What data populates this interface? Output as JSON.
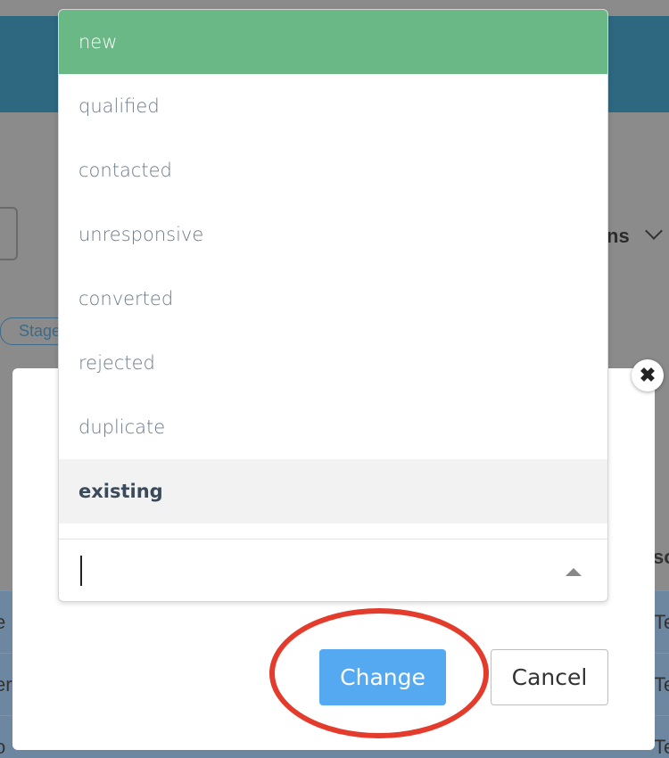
{
  "background": {
    "right_text": "ns",
    "tag_text": "Stage",
    "right_sliver_text": "so",
    "row_texts_left": [
      "e",
      "er",
      "o"
    ],
    "row_texts_right": [
      "Te",
      "Te",
      "Te"
    ]
  },
  "dropdown": {
    "options": [
      {
        "label": "new",
        "state": "highlighted"
      },
      {
        "label": "qualified",
        "state": "normal"
      },
      {
        "label": "contacted",
        "state": "normal"
      },
      {
        "label": "unresponsive",
        "state": "normal"
      },
      {
        "label": "converted",
        "state": "normal"
      },
      {
        "label": "rejected",
        "state": "normal"
      },
      {
        "label": "duplicate",
        "state": "normal"
      },
      {
        "label": "existing",
        "state": "selected"
      }
    ],
    "search_value": ""
  },
  "modal": {
    "close_icon": "close-icon",
    "change_label": "Change",
    "cancel_label": "Cancel"
  },
  "colors": {
    "highlight": "#69b886",
    "primary_button": "#55a9f0",
    "annotation": "#e33b2c"
  }
}
